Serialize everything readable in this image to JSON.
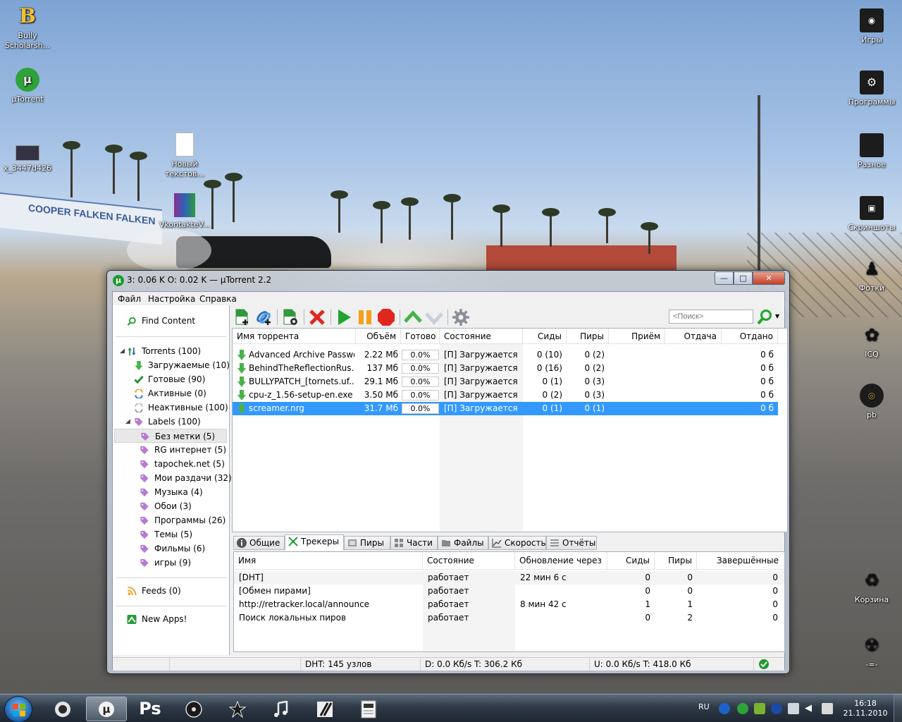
{
  "window": {
    "title": "3: 0.06 K O: 0.02 K — µTorrent 2.2",
    "minimize": "—",
    "maximize": "□",
    "close": "✕"
  },
  "menu": [
    "Файл",
    "Настройка",
    "Справка"
  ],
  "sidebar": {
    "find_content": "Find Content",
    "torrents": "Torrents (100)",
    "downloading": "Загружаемые (10)",
    "completed": "Готовые (90)",
    "active": "Активные (0)",
    "inactive": "Неактивные (100)",
    "labels": "Labels (100)",
    "label_items": [
      "Без метки (5)",
      "RG интернет (5)",
      "tapochek.net (5)",
      "Мои раздачи (32)",
      "Музыка (4)",
      "Обои (3)",
      "Программы (26)",
      "Темы (5)",
      "Фильмы (6)",
      "игры (9)"
    ],
    "feeds": "Feeds (0)",
    "new_apps": "New Apps!"
  },
  "toolbar": {
    "search_placeholder": "<Поиск>",
    "icons": [
      "add-torrent-icon",
      "add-url-icon",
      "create-torrent-icon",
      "remove-icon",
      "start-icon",
      "pause-icon",
      "stop-icon",
      "move-up-icon",
      "move-down-icon",
      "settings-icon",
      "search-icon"
    ]
  },
  "list": {
    "headers": [
      "Имя торрента",
      "Объём",
      "Готово",
      "Состояние",
      "Сиды",
      "Пиры",
      "Приём",
      "Отдача",
      "Отдано"
    ],
    "rows": [
      {
        "name": "Advanced Archive Passwo...",
        "size": "2.22 Мб",
        "done": "0.0%",
        "status": "[П] Загружается",
        "seeds": "0 (10)",
        "peers": "0 (2)",
        "uploaded": "0 б"
      },
      {
        "name": "BehindTheReflectionRus.e...",
        "size": "137 Мб",
        "done": "0.0%",
        "status": "[П] Загружается",
        "seeds": "0 (16)",
        "peers": "0 (2)",
        "uploaded": "0 б"
      },
      {
        "name": "BULLYPATCH_[tornets.uf...",
        "size": "29.1 Мб",
        "done": "0.0%",
        "status": "[П] Загружается",
        "seeds": "0 (1)",
        "peers": "0 (3)",
        "uploaded": "0 б"
      },
      {
        "name": "cpu-z_1.56-setup-en.exe",
        "size": "3.50 Мб",
        "done": "0.0%",
        "status": "[П] Загружается",
        "seeds": "0 (2)",
        "peers": "0 (3)",
        "uploaded": "0 б"
      },
      {
        "name": "screamer.nrg",
        "size": "31.7 Мб",
        "done": "0.0%",
        "status": "[П] Загружается",
        "seeds": "0 (1)",
        "peers": "0 (1)",
        "uploaded": "0 б"
      }
    ]
  },
  "tabs": [
    "Общие",
    "Трекеры",
    "Пиры",
    "Части",
    "Файлы",
    "Скорость",
    "Отчёты"
  ],
  "trackers": {
    "headers": [
      "Имя",
      "Состояние",
      "Обновление через",
      "Сиды",
      "Пиры",
      "Завершённые"
    ],
    "rows": [
      {
        "name": "[DHT]",
        "status": "работает",
        "update": "22 мин 6 с",
        "seeds": "0",
        "peers": "0",
        "completed": "0"
      },
      {
        "name": "[Обмен пирами]",
        "status": "работает",
        "update": "",
        "seeds": "0",
        "peers": "0",
        "completed": "0"
      },
      {
        "name": "http://retracker.local/announce",
        "status": "работает",
        "update": "8 мин 42 с",
        "seeds": "1",
        "peers": "1",
        "completed": "0"
      },
      {
        "name": "Поиск локальных пиров",
        "status": "работает",
        "update": "",
        "seeds": "0",
        "peers": "2",
        "completed": "0"
      }
    ]
  },
  "statusbar": {
    "dht": "DHT: 145 узлов",
    "download": "D: 0.0 Кб/s T: 306.2 Кб",
    "upload": "U: 0.0 Кб/s T: 418.0 Кб"
  },
  "desktop_icons": {
    "left": [
      {
        "label": "Bully Scholarsh...",
        "glyph": "B"
      },
      {
        "label": "µTorrent",
        "glyph": "µ"
      },
      {
        "label": "x_3447d426",
        "glyph": ""
      },
      {
        "label": "Новый текстов...",
        "glyph": ""
      },
      {
        "label": "VkontakteV...",
        "glyph": ""
      }
    ],
    "right": [
      "Игры",
      "Программы",
      "Разное",
      "Скриншоты",
      "Фотки",
      "ICQ",
      "pb",
      "Корзина",
      "-=-"
    ]
  },
  "wallpaper_text": [
    "COOPER",
    "FALKEN",
    "FALKEN"
  ],
  "taskbar": {
    "apps": [
      "firefox",
      "utorrent",
      "Ps",
      "media",
      "star",
      "music",
      "notes",
      "file"
    ],
    "ps_label": "Ps",
    "lang": "RU",
    "time": "16:18",
    "date": "21.11.2010"
  },
  "colors": {
    "selection": "#3399ff",
    "green": "#22a52e",
    "red": "#e0261f",
    "orange": "#f5a01a",
    "label_purple": "#b77ad0"
  }
}
